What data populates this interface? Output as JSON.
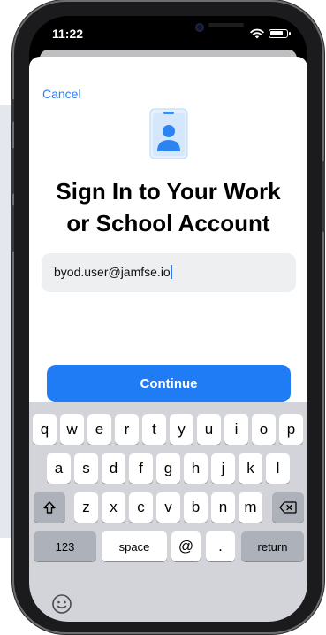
{
  "status_bar": {
    "time": "11:22"
  },
  "sheet": {
    "cancel_label": "Cancel",
    "title_line1": "Sign In to Your Work",
    "title_line2": "or School Account",
    "email_value": "byod.user@jamfse.io",
    "continue_label": "Continue"
  },
  "keyboard": {
    "row1": [
      "q",
      "w",
      "e",
      "r",
      "t",
      "y",
      "u",
      "i",
      "o",
      "p"
    ],
    "row2": [
      "a",
      "s",
      "d",
      "f",
      "g",
      "h",
      "j",
      "k",
      "l"
    ],
    "row3": [
      "z",
      "x",
      "c",
      "v",
      "b",
      "n",
      "m"
    ],
    "numbers_label": "123",
    "space_label": "space",
    "at_label": "@",
    "dot_label": ".",
    "return_label": "return"
  },
  "icons": {
    "id_badge": "id-badge-icon",
    "shift": "shift-icon",
    "backspace": "backspace-icon",
    "emoji": "emoji-icon",
    "wifi": "wifi-icon",
    "battery": "battery-icon"
  },
  "colors": {
    "accent": "#1f7cf5",
    "field_bg": "#eeeff1",
    "keyboard_bg": "#d2d4d9"
  }
}
